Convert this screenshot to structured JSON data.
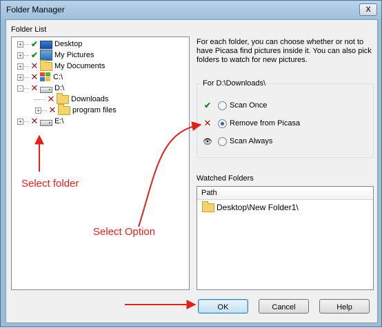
{
  "window": {
    "title": "Folder Manager",
    "close_glyph": "X"
  },
  "folder_list": {
    "label": "Folder List",
    "items": [
      {
        "label": "Desktop",
        "status": "check",
        "icon": "desktop-icon",
        "expander": "+"
      },
      {
        "label": "My Pictures",
        "status": "check",
        "icon": "pictures-icon",
        "expander": "+"
      },
      {
        "label": "My Documents",
        "status": "x",
        "icon": "folder-icon",
        "expander": "+"
      },
      {
        "label": "C:\\",
        "status": "x",
        "icon": "windows-drive-icon",
        "expander": "+"
      },
      {
        "label": "D:\\",
        "status": "x",
        "icon": "drive-icon",
        "expander": "-"
      },
      {
        "label": "Downloads",
        "status": "x",
        "icon": "folder-icon",
        "expander": ""
      },
      {
        "label": "program files",
        "status": "x",
        "icon": "folder-icon",
        "expander": "+"
      },
      {
        "label": "E:\\",
        "status": "x",
        "icon": "drive-icon",
        "expander": "+"
      }
    ]
  },
  "description": {
    "line1": "For each folder, you can choose whether or not to",
    "line2": "have Picasa find pictures inside it.  You can also pick",
    "line3": "folders to watch for new pictures."
  },
  "options": {
    "group_title": "For D:\\Downloads\\",
    "scan_once": "Scan Once",
    "remove": "Remove from Picasa",
    "scan_always": "Scan Always",
    "selected": "remove"
  },
  "watched": {
    "label": "Watched Folders",
    "column": "Path",
    "rows": [
      "Desktop\\New Folder1\\"
    ]
  },
  "buttons": {
    "ok": "OK",
    "cancel": "Cancel",
    "help": "Help"
  },
  "annotations": {
    "select_folder": "Select folder",
    "select_option": "Select Option"
  },
  "colors": {
    "annotation": "#e0201b",
    "check": "#1a8c1a",
    "cross": "#a01010",
    "accent": "#2a62b8"
  }
}
